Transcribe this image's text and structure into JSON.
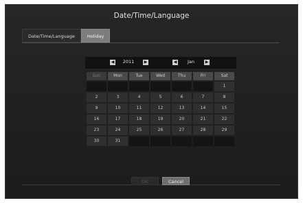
{
  "dialog": {
    "title": "Date/Time/Language"
  },
  "tabs": [
    {
      "label": "Date/Time/Language",
      "active": false
    },
    {
      "label": "Holiday",
      "active": true
    }
  ],
  "calendar": {
    "year": "2011",
    "month": "Jan",
    "weekdays": [
      "Sun",
      "Mon",
      "Tue",
      "Wed",
      "Thu",
      "Fri",
      "Sat"
    ],
    "days": [
      "",
      "",
      "",
      "",
      "",
      "",
      "1",
      "2",
      "3",
      "4",
      "5",
      "6",
      "7",
      "8",
      "9",
      "10",
      "11",
      "12",
      "13",
      "14",
      "15",
      "16",
      "17",
      "18",
      "19",
      "20",
      "21",
      "22",
      "23",
      "24",
      "25",
      "26",
      "27",
      "28",
      "29",
      "30",
      "31",
      "",
      "",
      "",
      "",
      ""
    ]
  },
  "buttons": {
    "ok": "OK",
    "cancel": "Cancel"
  }
}
